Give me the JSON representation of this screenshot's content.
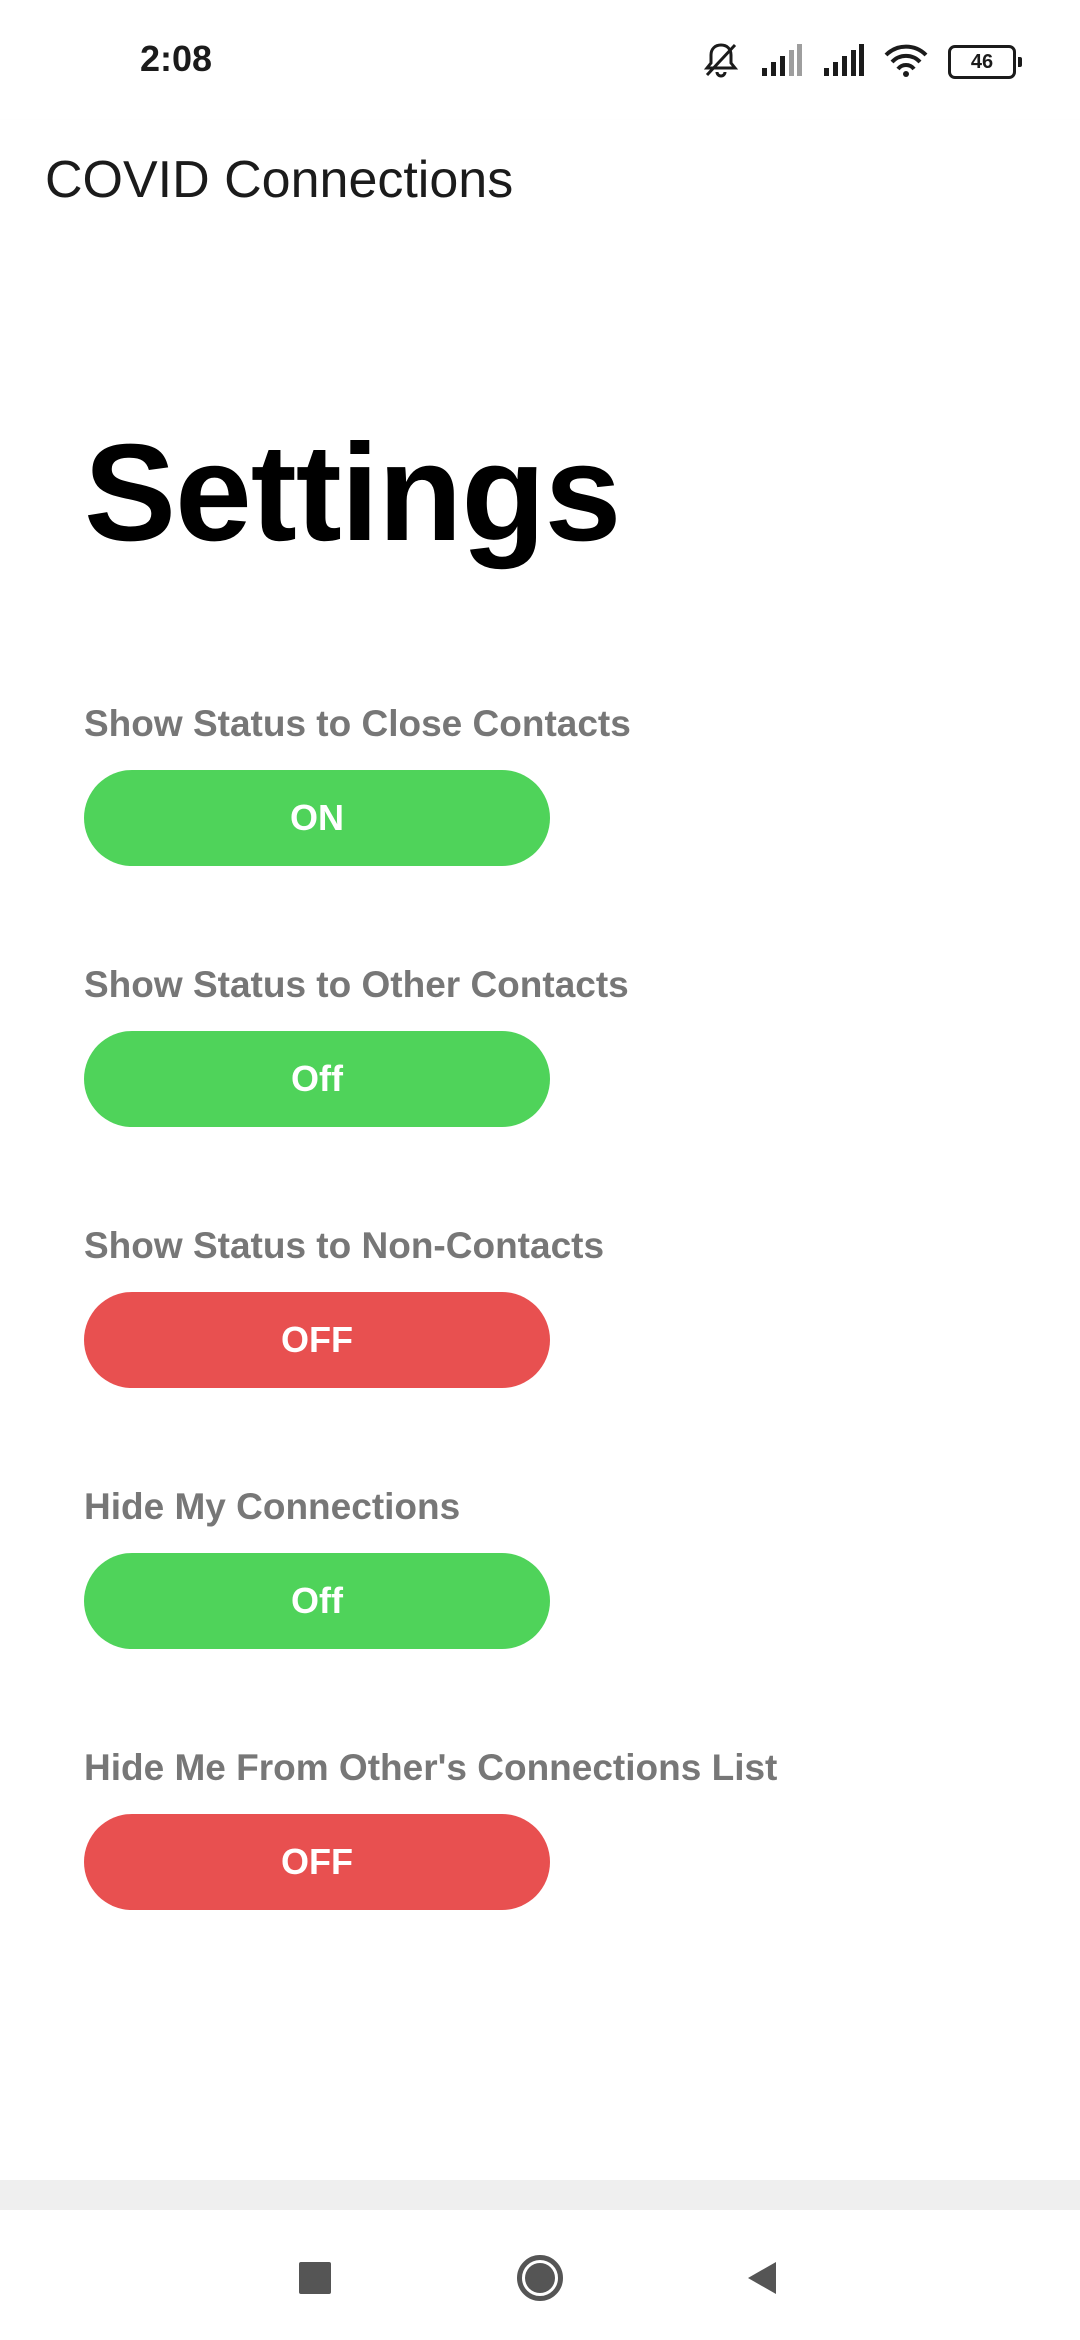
{
  "status_bar": {
    "time": "2:08",
    "battery_level": "46",
    "icons": [
      "silent-mode-icon",
      "signal-icon",
      "signal-icon",
      "wifi-icon",
      "battery-icon"
    ]
  },
  "app_bar": {
    "title": "COVID Connections"
  },
  "page": {
    "title": "Settings"
  },
  "settings": [
    {
      "label": "Show Status to Close Contacts",
      "value": "ON",
      "color": "#4fd35a"
    },
    {
      "label": "Show Status to Other Contacts",
      "value": "Off",
      "color": "#4fd35a"
    },
    {
      "label": "Show Status to Non-Contacts",
      "value": "OFF",
      "color": "#e85050"
    },
    {
      "label": "Hide My Connections",
      "value": "Off",
      "color": "#4fd35a"
    },
    {
      "label": "Hide Me From Other's Connections List",
      "value": "OFF",
      "color": "#e85050"
    }
  ],
  "nav_bar": {
    "icons": [
      "recents-icon",
      "home-icon",
      "back-icon"
    ]
  },
  "colors": {
    "on_green": "#4fd35a",
    "off_red": "#e85050",
    "label_gray": "#777777"
  }
}
